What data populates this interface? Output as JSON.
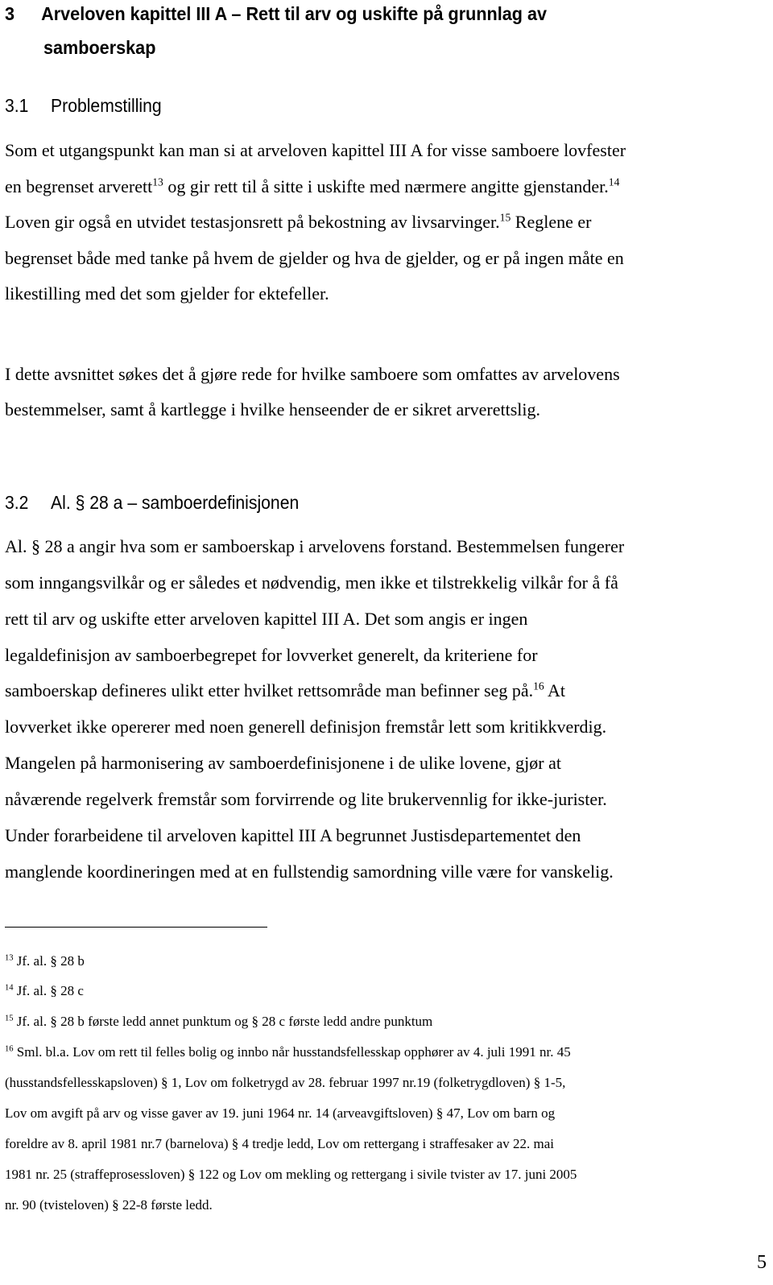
{
  "heading1": {
    "number": "3",
    "line1": "Arveloven kapittel III A – Rett til arv og uskifte på grunnlag av",
    "line2": "samboerskap"
  },
  "section31": {
    "number": "3.1",
    "title": "Problemstilling",
    "para1": {
      "l1": "Som et utgangspunkt kan man si at arveloven kapittel III A for visse samboere lovfester",
      "l2a": "en begrenset arverett",
      "fn13": "13",
      "l2b": " og gir rett til å sitte i uskifte med nærmere angitte gjenstander.",
      "fn14": "14",
      "l3a": "Loven gir også en utvidet testasjonsrett på bekostning av livsarvinger.",
      "fn15": "15",
      "l3b": " Reglene er",
      "l4": "begrenset både med tanke på hvem de gjelder og hva de gjelder, og er på ingen måte en",
      "l5": "likestilling med det som gjelder for ektefeller."
    },
    "para2": {
      "l1": "I dette avsnittet søkes det å gjøre rede for hvilke samboere som omfattes av arvelovens",
      "l2": "bestemmelser, samt å kartlegge i hvilke henseender de er sikret arverettslig."
    }
  },
  "section32": {
    "number": "3.2",
    "title": "Al. § 28 a – samboerdefinisjonen",
    "para": {
      "l1": "Al. § 28 a angir hva som er samboerskap i arvelovens forstand. Bestemmelsen fungerer",
      "l2": "som inngangsvilkår og er således et nødvendig, men ikke et tilstrekkelig vilkår for å få",
      "l3": "rett til arv og uskifte etter arveloven kapittel III A. Det som angis er ingen",
      "l4": "legaldefinisjon av samboerbegrepet for lovverket generelt, da kriteriene for",
      "l5a": "samboerskap defineres ulikt etter hvilket rettsområde man befinner seg på.",
      "fn16": "16",
      "l5b": " At",
      "l6": "lovverket ikke opererer med noen generell definisjon fremstår lett som kritikkverdig.",
      "l7": "Mangelen på harmonisering av samboerdefinisjonene i de ulike lovene, gjør at",
      "l8": "nåværende regelverk fremstår som forvirrende og lite brukervennlig for ikke-jurister.",
      "l9": "Under forarbeidene til arveloven kapittel III A begrunnet Justisdepartementet den",
      "l10": "manglende koordineringen med at en fullstendig samordning ville være for vanskelig."
    }
  },
  "footnotes": [
    {
      "num": "13",
      "lines": [
        "Jf. al. § 28 b"
      ]
    },
    {
      "num": "14",
      "lines": [
        "Jf. al. § 28 c"
      ]
    },
    {
      "num": "15",
      "lines": [
        "Jf. al. § 28 b første ledd annet punktum og § 28 c første ledd andre punktum"
      ]
    },
    {
      "num": "16",
      "lines": [
        "Sml. bl.a. Lov om rett til felles bolig og innbo når husstandsfellesskap opphører av 4. juli 1991 nr. 45",
        "(husstandsfellesskapsloven) § 1, Lov om folketrygd av 28. februar 1997 nr.19 (folketrygdloven) § 1-5,",
        "Lov om avgift på arv og visse gaver av 19. juni 1964 nr. 14 (arveavgiftsloven) § 47, Lov om barn og",
        "foreldre av 8. april 1981 nr.7 (barnelova) § 4 tredje ledd, Lov om rettergang i straffesaker av 22. mai",
        "1981 nr. 25 (straffeprosessloven) § 122 og Lov om mekling og rettergang i sivile tvister av 17. juni 2005",
        "nr. 90 (tvisteloven) § 22-8 første ledd."
      ]
    }
  ],
  "page_number": "5"
}
